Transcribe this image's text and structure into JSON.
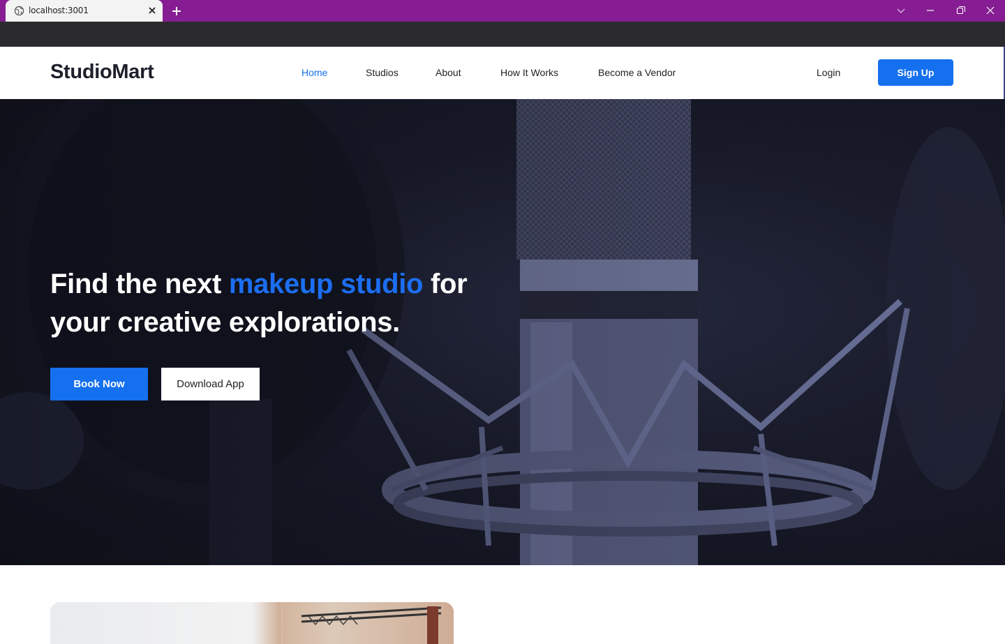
{
  "browser": {
    "tab_title": "localhost:3001",
    "icons": [
      "globe-icon",
      "close-icon",
      "plus-icon",
      "chevron-down-icon",
      "minimize-icon",
      "restore-icon",
      "close-window-icon"
    ]
  },
  "nav": {
    "logo": "StudioMart",
    "links": [
      {
        "label": "Home",
        "active": true
      },
      {
        "label": "Studios",
        "active": false
      },
      {
        "label": "About",
        "active": false
      },
      {
        "label": "How It Works",
        "active": false
      },
      {
        "label": "Become a Vendor",
        "active": false
      }
    ],
    "login": "Login",
    "signup": "Sign Up"
  },
  "hero": {
    "headline_part1": "Find the next ",
    "headline_accent": "makeup studio",
    "headline_part2": " for your creative explorations.",
    "primary_button": "Book Now",
    "secondary_button": "Download App"
  },
  "colors": {
    "browser_tabbar": "#861d92",
    "accent_blue": "#1570ef",
    "hero_dark": "#161826"
  }
}
